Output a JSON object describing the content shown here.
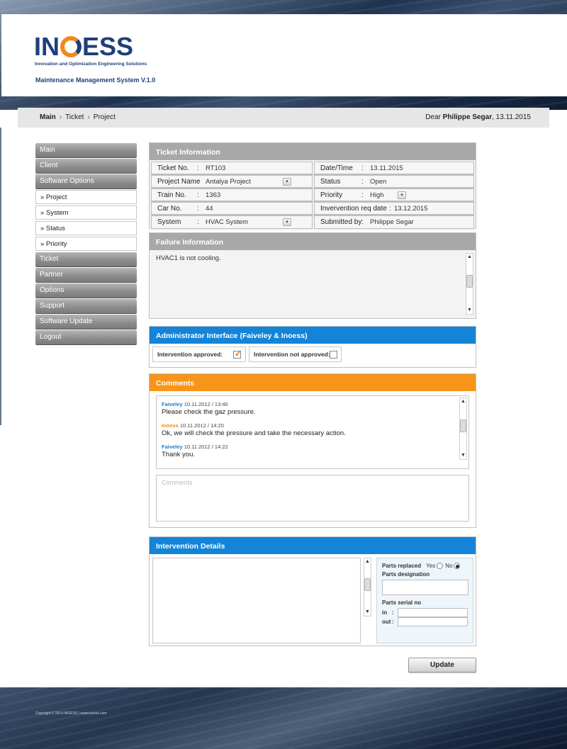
{
  "header": {
    "logo_left": "IN",
    "logo_right": "ESS",
    "logo_tagline": "Innovation and Optimization Engineering Solutions",
    "app_title": "Maintenance Management System V.1.0"
  },
  "breadcrumb": {
    "items": [
      "Main",
      "Ticket",
      "Project"
    ],
    "greeting_prefix": "Dear",
    "user_name": "Philippe Segar",
    "date": ", 13.11.2015"
  },
  "sidebar": {
    "items": [
      {
        "label": "Main"
      },
      {
        "label": "Client"
      },
      {
        "label": "Software Options"
      }
    ],
    "subitems": [
      {
        "label": "» Project"
      },
      {
        "label": "» System"
      },
      {
        "label": "» Status"
      },
      {
        "label": "» Priority"
      }
    ],
    "items_after": [
      {
        "label": "Ticket"
      },
      {
        "label": "Partner"
      },
      {
        "label": "Options"
      },
      {
        "label": "Support"
      },
      {
        "label": "Software Update"
      },
      {
        "label": "Logout"
      }
    ]
  },
  "ticket_info": {
    "title": "Ticket Information",
    "left": [
      {
        "label": "Ticket No.",
        "value": "RT103"
      },
      {
        "label": "Project Name",
        "value": "Antalya Project"
      },
      {
        "label": "Train No.",
        "value": "1363"
      },
      {
        "label": "Car No.",
        "value": "44"
      },
      {
        "label": "System",
        "value": "HVAC System"
      }
    ],
    "right": [
      {
        "label": "Date/Time",
        "value": "13.11.2015"
      },
      {
        "label": "Status",
        "value": "Open"
      },
      {
        "label": "Priority",
        "value": "High"
      },
      {
        "label": "Invervention req date",
        "value": "13.12.2015"
      },
      {
        "label": "Submitted by",
        "value": "Philippe Segar"
      }
    ]
  },
  "failure_info": {
    "title": "Failure Information",
    "text": "HVAC1 is not cooling."
  },
  "admin": {
    "title": "Administrator Interface (Faiveley & Inoess)",
    "approved_label": "Intervention approved:",
    "approved_checked": true,
    "not_approved_label": "Intervention not approved:",
    "not_approved_checked": false
  },
  "comments": {
    "title": "Comments",
    "items": [
      {
        "author": "Faiveley",
        "time": "10.11.2012 / 13:40",
        "text": "Please check the gaz pressure.",
        "color": "#1a7cc8"
      },
      {
        "author": "Inoess",
        "time": "10.11.2012 / 14:20",
        "text": "Ok, we will check the pressure and take the necessary action.",
        "color": "#f08a1c"
      },
      {
        "author": "Faiveley",
        "time": "10.11.2012 / 14:22",
        "text": "Thank you.",
        "color": "#1a7cc8"
      }
    ],
    "input_placeholder": "Comments"
  },
  "intervention": {
    "title": "Intervention Details",
    "parts_replaced_label": "Parts replaced",
    "yes_label": "Yes",
    "no_label": "No",
    "parts_replaced_value": "No",
    "parts_designation_label": "Parts designation",
    "parts_serial_label": "Parts serial no",
    "in_label": "in",
    "out_label": "out"
  },
  "update_label": "Update",
  "footer": {
    "copyright": "Copyright © 2014 INOESS | www.inoess.com"
  },
  "colors": {
    "brand_navy": "#1f3f7a",
    "brand_orange": "#f08a1c",
    "head_blue": "#1384d8",
    "head_orange": "#f7951b",
    "head_gray": "#a8a8a8"
  }
}
